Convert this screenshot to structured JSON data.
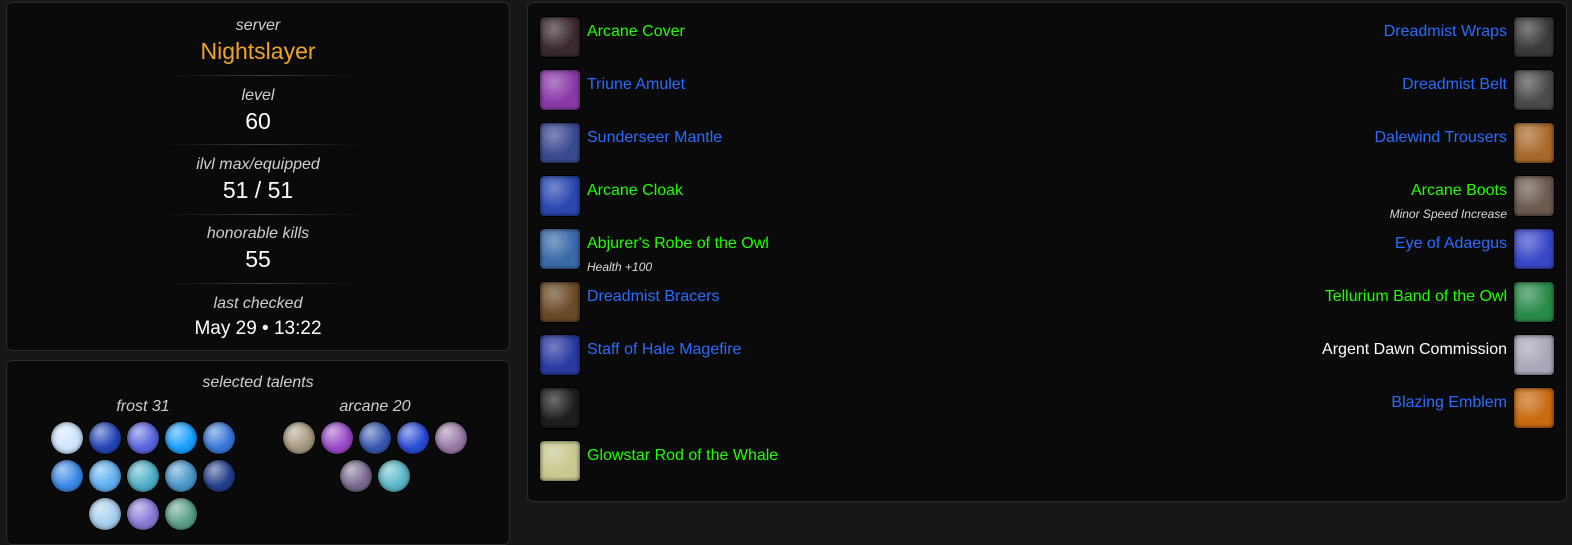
{
  "character": {
    "server_label": "server",
    "server": "Nightslayer",
    "level_label": "level",
    "level": "60",
    "ilvl_label": "ilvl max/equipped",
    "ilvl": "51 / 51",
    "hk_label": "honorable kills",
    "hk": "55",
    "checked_label": "last checked",
    "checked": "May 29 • 13:22"
  },
  "talents": {
    "title": "selected talents",
    "trees": [
      {
        "name": "frost 31",
        "icons": [
          {
            "name": "frost-talent-icon-1",
            "color": "#cfe6ff"
          },
          {
            "name": "frost-talent-icon-2",
            "color": "#2446b8"
          },
          {
            "name": "frost-talent-icon-3",
            "color": "#5a66e0"
          },
          {
            "name": "frost-talent-icon-4",
            "color": "#1aa0ff"
          },
          {
            "name": "frost-talent-icon-5",
            "color": "#3a78d8"
          },
          {
            "name": "frost-talent-icon-6",
            "color": "#3c8ae8"
          },
          {
            "name": "frost-talent-icon-7",
            "color": "#60b0f0"
          },
          {
            "name": "frost-talent-icon-8",
            "color": "#4fb0c8"
          },
          {
            "name": "frost-talent-icon-9",
            "color": "#4a98c8"
          },
          {
            "name": "frost-talent-icon-10",
            "color": "#24408a"
          },
          {
            "name": "frost-talent-icon-11",
            "color": "#a8cff0"
          },
          {
            "name": "frost-talent-icon-12",
            "color": "#8a7ad8"
          },
          {
            "name": "frost-talent-icon-13",
            "color": "#5aa088"
          }
        ]
      },
      {
        "name": "arcane 20",
        "icons": [
          {
            "name": "arcane-talent-icon-1",
            "color": "#a89a80"
          },
          {
            "name": "arcane-talent-icon-2",
            "color": "#9a4ac8"
          },
          {
            "name": "arcane-talent-icon-3",
            "color": "#3858b0"
          },
          {
            "name": "arcane-talent-icon-4",
            "color": "#2a4cd8"
          },
          {
            "name": "arcane-talent-icon-5",
            "color": "#9a7aa8"
          },
          {
            "name": "arcane-talent-icon-6",
            "color": "#7a6a90"
          },
          {
            "name": "arcane-talent-icon-7",
            "color": "#5ab8c8"
          }
        ]
      }
    ]
  },
  "gear": {
    "left": [
      {
        "name": "Arcane Cover",
        "quality": "green",
        "enchant": "",
        "icon_color": "#3a2a2e",
        "icon_name": "head-slot-icon"
      },
      {
        "name": "Triune Amulet",
        "quality": "blue",
        "enchant": "",
        "icon_color": "#8a3aa8",
        "icon_name": "neck-slot-icon"
      },
      {
        "name": "Sunderseer Mantle",
        "quality": "blue",
        "enchant": "",
        "icon_color": "#3a4a90",
        "icon_name": "shoulder-slot-icon"
      },
      {
        "name": "Arcane Cloak",
        "quality": "green",
        "enchant": "",
        "icon_color": "#2a48b0",
        "icon_name": "back-slot-icon"
      },
      {
        "name": "Abjurer's Robe of the Owl",
        "quality": "green",
        "enchant": "Health +100",
        "icon_color": "#3a6aa8",
        "icon_name": "chest-slot-icon"
      },
      {
        "name": "Dreadmist Bracers",
        "quality": "blue",
        "enchant": "",
        "icon_color": "#6a4a28",
        "icon_name": "wrist-slot-icon"
      },
      {
        "name": "Staff of Hale Magefire",
        "quality": "blue",
        "enchant": "",
        "icon_color": "#2a3aa0",
        "icon_name": "mainhand-slot-icon"
      },
      {
        "name": "",
        "quality": "white",
        "enchant": "",
        "icon_color": "#1e1e1e",
        "icon_name": "offhand-slot-empty-icon"
      },
      {
        "name": "Glowstar Rod of the Whale",
        "quality": "green",
        "enchant": "",
        "icon_color": "#c8c890",
        "icon_name": "ranged-slot-icon"
      }
    ],
    "right": [
      {
        "name": "Dreadmist Wraps",
        "quality": "blue",
        "enchant": "",
        "icon_color": "#3a3a3a",
        "icon_name": "hands-slot-icon"
      },
      {
        "name": "Dreadmist Belt",
        "quality": "blue",
        "enchant": "",
        "icon_color": "#4a4a4a",
        "icon_name": "waist-slot-icon"
      },
      {
        "name": "Dalewind Trousers",
        "quality": "blue",
        "enchant": "",
        "icon_color": "#a86a2a",
        "icon_name": "legs-slot-icon"
      },
      {
        "name": "Arcane Boots",
        "quality": "green",
        "enchant": "Minor Speed Increase",
        "icon_color": "#6a5a50",
        "icon_name": "feet-slot-icon"
      },
      {
        "name": "Eye of Adaegus",
        "quality": "blue",
        "enchant": "",
        "icon_color": "#3a48c8",
        "icon_name": "finger1-slot-icon"
      },
      {
        "name": "Tellurium Band of the Owl",
        "quality": "green",
        "enchant": "",
        "icon_color": "#2a8a4a",
        "icon_name": "finger2-slot-icon"
      },
      {
        "name": "Argent Dawn Commission",
        "quality": "white",
        "enchant": "",
        "icon_color": "#a8a8b8",
        "icon_name": "trinket1-slot-icon"
      },
      {
        "name": "Blazing Emblem",
        "quality": "blue",
        "enchant": "",
        "icon_color": "#c86a10",
        "icon_name": "trinket2-slot-icon"
      }
    ]
  }
}
